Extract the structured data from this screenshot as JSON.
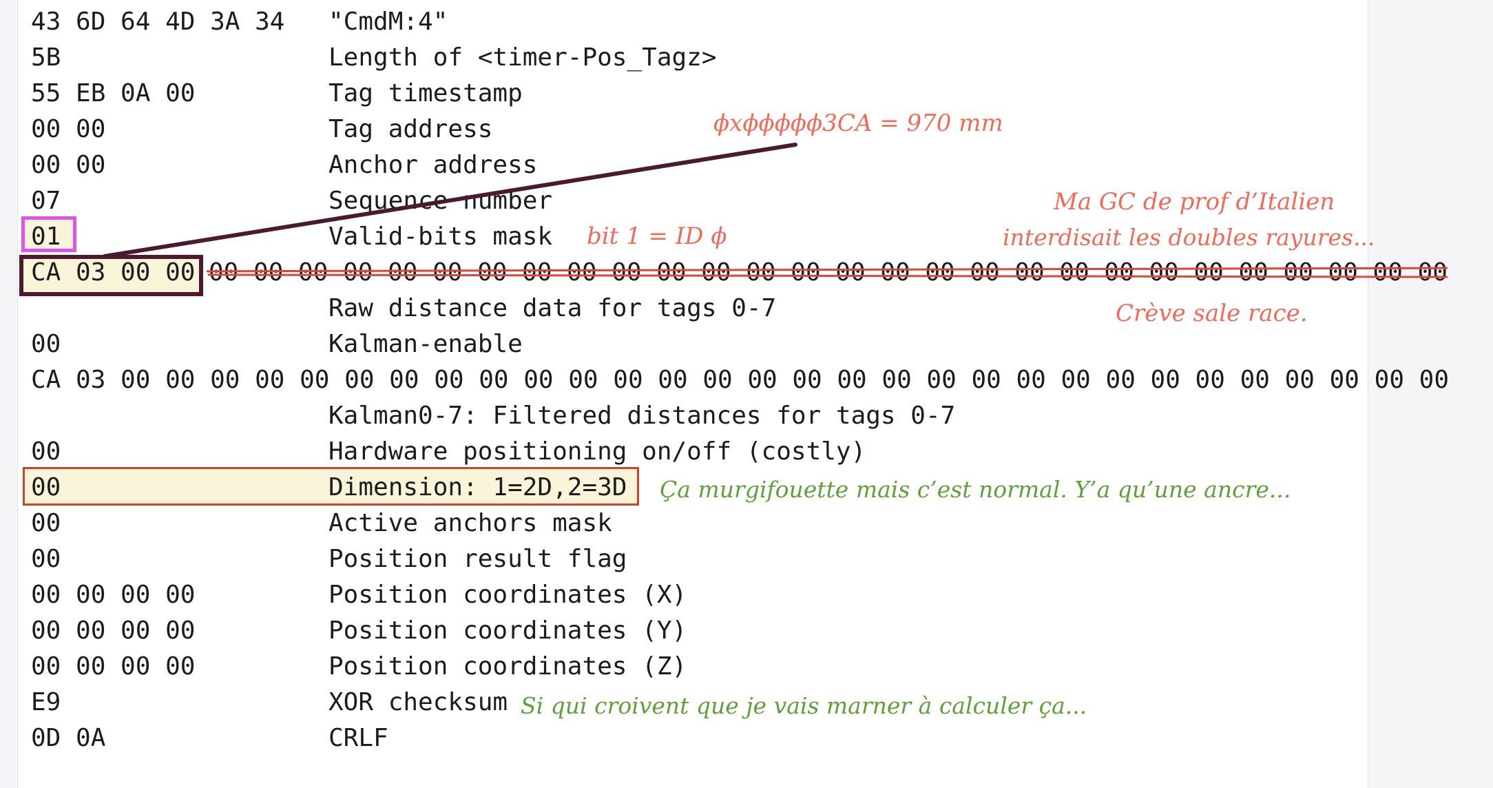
{
  "rows": [
    {
      "hex": "43 6D 64 4D 3A 34",
      "desc": "\"CmdM:4\""
    },
    {
      "hex": "5B",
      "desc": "Length of <timer-Pos_Tagz>"
    },
    {
      "hex": "55 EB 0A 00",
      "desc": "Tag timestamp"
    },
    {
      "hex": "00 00",
      "desc": "Tag address"
    },
    {
      "hex": "00 00",
      "desc": "Anchor address"
    },
    {
      "hex": "07",
      "desc": "Sequence number"
    },
    {
      "hex": "01",
      "desc": "Valid-bits mask"
    },
    {
      "hex": "CA 03 00 00",
      "hex_rest": "00 00 00 00 00 00 00 00 00 00 00 00 00 00 00 00 00 00 00 00 00 00 00 00 00 00 00 00",
      "desc": ""
    },
    {
      "hex": "",
      "desc": "Raw distance data for tags 0-7"
    },
    {
      "hex": "00",
      "desc": "Kalman-enable"
    },
    {
      "hex": "CA 03 00 00 00 00 00 00 00 00 00 00 00 00 00 00 00 00 00 00 00 00 00 00 00 00 00 00 00 00 00 00",
      "desc": ""
    },
    {
      "hex": "",
      "desc": "Kalman0-7: Filtered distances for tags 0-7"
    },
    {
      "hex": "00",
      "desc": "Hardware positioning on/off (costly)"
    },
    {
      "hex": "00",
      "desc": "Dimension: 1=2D,2=3D"
    },
    {
      "hex": "00",
      "desc": "Active anchors mask"
    },
    {
      "hex": "00",
      "desc": "Position result flag"
    },
    {
      "hex": "00 00 00 00",
      "desc": "Position coordinates (X)"
    },
    {
      "hex": "00 00 00 00",
      "desc": "Position coordinates (Y)"
    },
    {
      "hex": "00 00 00 00",
      "desc": "Position coordinates (Z)"
    },
    {
      "hex": "E9",
      "desc": "XOR checksum"
    },
    {
      "hex": "0D 0A",
      "desc": "CRLF"
    }
  ],
  "annotations": {
    "distance": "ϕxϕϕϕϕϕ3CA = 970 mm",
    "bit": "bit 1 = ID ϕ",
    "italian_line1": "Ma GC de prof d’Italien",
    "italian_line2": "interdisait les doubles rayures...",
    "race": "Crève sale race.",
    "dimension": "Ça murgifouette mais c’est normal. Y’a qu’une ancre...",
    "checksum": "Si qui croivent que je vais marner à calculer ça..."
  },
  "colors": {
    "annotation_red": "#f06a58",
    "annotation_green": "#5fa03a",
    "highlight_purple": "#e052e8",
    "highlight_dark": "#4b1a31",
    "highlight_red": "#c9452a",
    "strike": "#d9463a",
    "highlight_fill": "#faf5d9"
  }
}
